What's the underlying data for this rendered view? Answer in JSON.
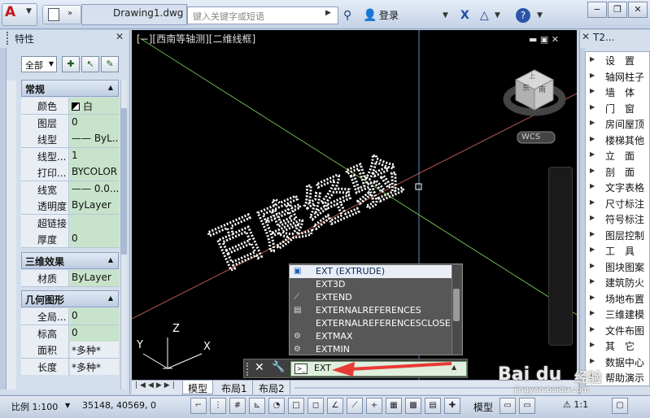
{
  "app": {
    "document_title": "Drawing1.dwg",
    "search_placeholder": "键入关键字或短语",
    "login_label": "登录"
  },
  "properties_panel": {
    "title": "特性",
    "filter_value": "全部",
    "sections": [
      {
        "title": "常规",
        "rows": [
          {
            "key": "颜色",
            "value": "白"
          },
          {
            "key": "图层",
            "value": "0"
          },
          {
            "key": "线型",
            "value": "—— ByL..."
          },
          {
            "key": "线型...",
            "value": "1"
          },
          {
            "key": "打印...",
            "value": "BYCOLOR"
          },
          {
            "key": "线宽",
            "value": "—— 0.0..."
          },
          {
            "key": "透明度",
            "value": "ByLayer"
          },
          {
            "key": "超链接",
            "value": ""
          },
          {
            "key": "厚度",
            "value": "0"
          }
        ]
      },
      {
        "title": "三维效果",
        "rows": [
          {
            "key": "材质",
            "value": "ByLayer"
          }
        ]
      },
      {
        "title": "几何图形",
        "rows": [
          {
            "key": "全局...",
            "value": "0"
          },
          {
            "key": "标高",
            "value": "0"
          },
          {
            "key": "面积",
            "value": "*多种*"
          },
          {
            "key": "长度",
            "value": "*多种*"
          }
        ]
      }
    ]
  },
  "viewport": {
    "label": "[−][西南等轴测][二维线框]",
    "viewcube_top": "上",
    "viewcube_left": "东",
    "viewcube_right": "南",
    "wcs_label": "WCS",
    "axis_x": "X",
    "axis_y": "Y",
    "axis_z": "Z",
    "drawing_text": "百度经验"
  },
  "autocomplete": {
    "items": [
      "EXT (EXTRUDE)",
      "EXT3D",
      "EXTEND",
      "EXTERNALREFERENCES",
      "EXTERNALREFERENCESCLOSE",
      "EXTMAX",
      "EXTMIN"
    ]
  },
  "command_line": {
    "input_value": "EXT"
  },
  "layout_tabs": [
    "模型",
    "布局1",
    "布局2"
  ],
  "tool_palette": {
    "title": "T2...",
    "items": [
      "设　置",
      "轴网柱子",
      "墙　体",
      "门　窗",
      "房间屋顶",
      "楼梯其他",
      "立　面",
      "剖　面",
      "文字表格",
      "尺寸标注",
      "符号标注",
      "图层控制",
      "工　具",
      "图块图案",
      "建筑防火",
      "场地布置",
      "三维建模",
      "文件布图",
      "其　它",
      "数据中心",
      "帮助演示"
    ]
  },
  "status_bar": {
    "scale": "比例 1:100",
    "coords": "35148, 40569, 0",
    "model_label": "模型",
    "annotation_scale": "1:1"
  },
  "watermark": {
    "brand": "Bai du",
    "product": "经验",
    "url": "jingyan.baidu.com"
  },
  "colors": {
    "accent_red": "#e83a36",
    "property_value_bg": "#c8e3cb",
    "command_input_bg": "#dfeedd"
  }
}
